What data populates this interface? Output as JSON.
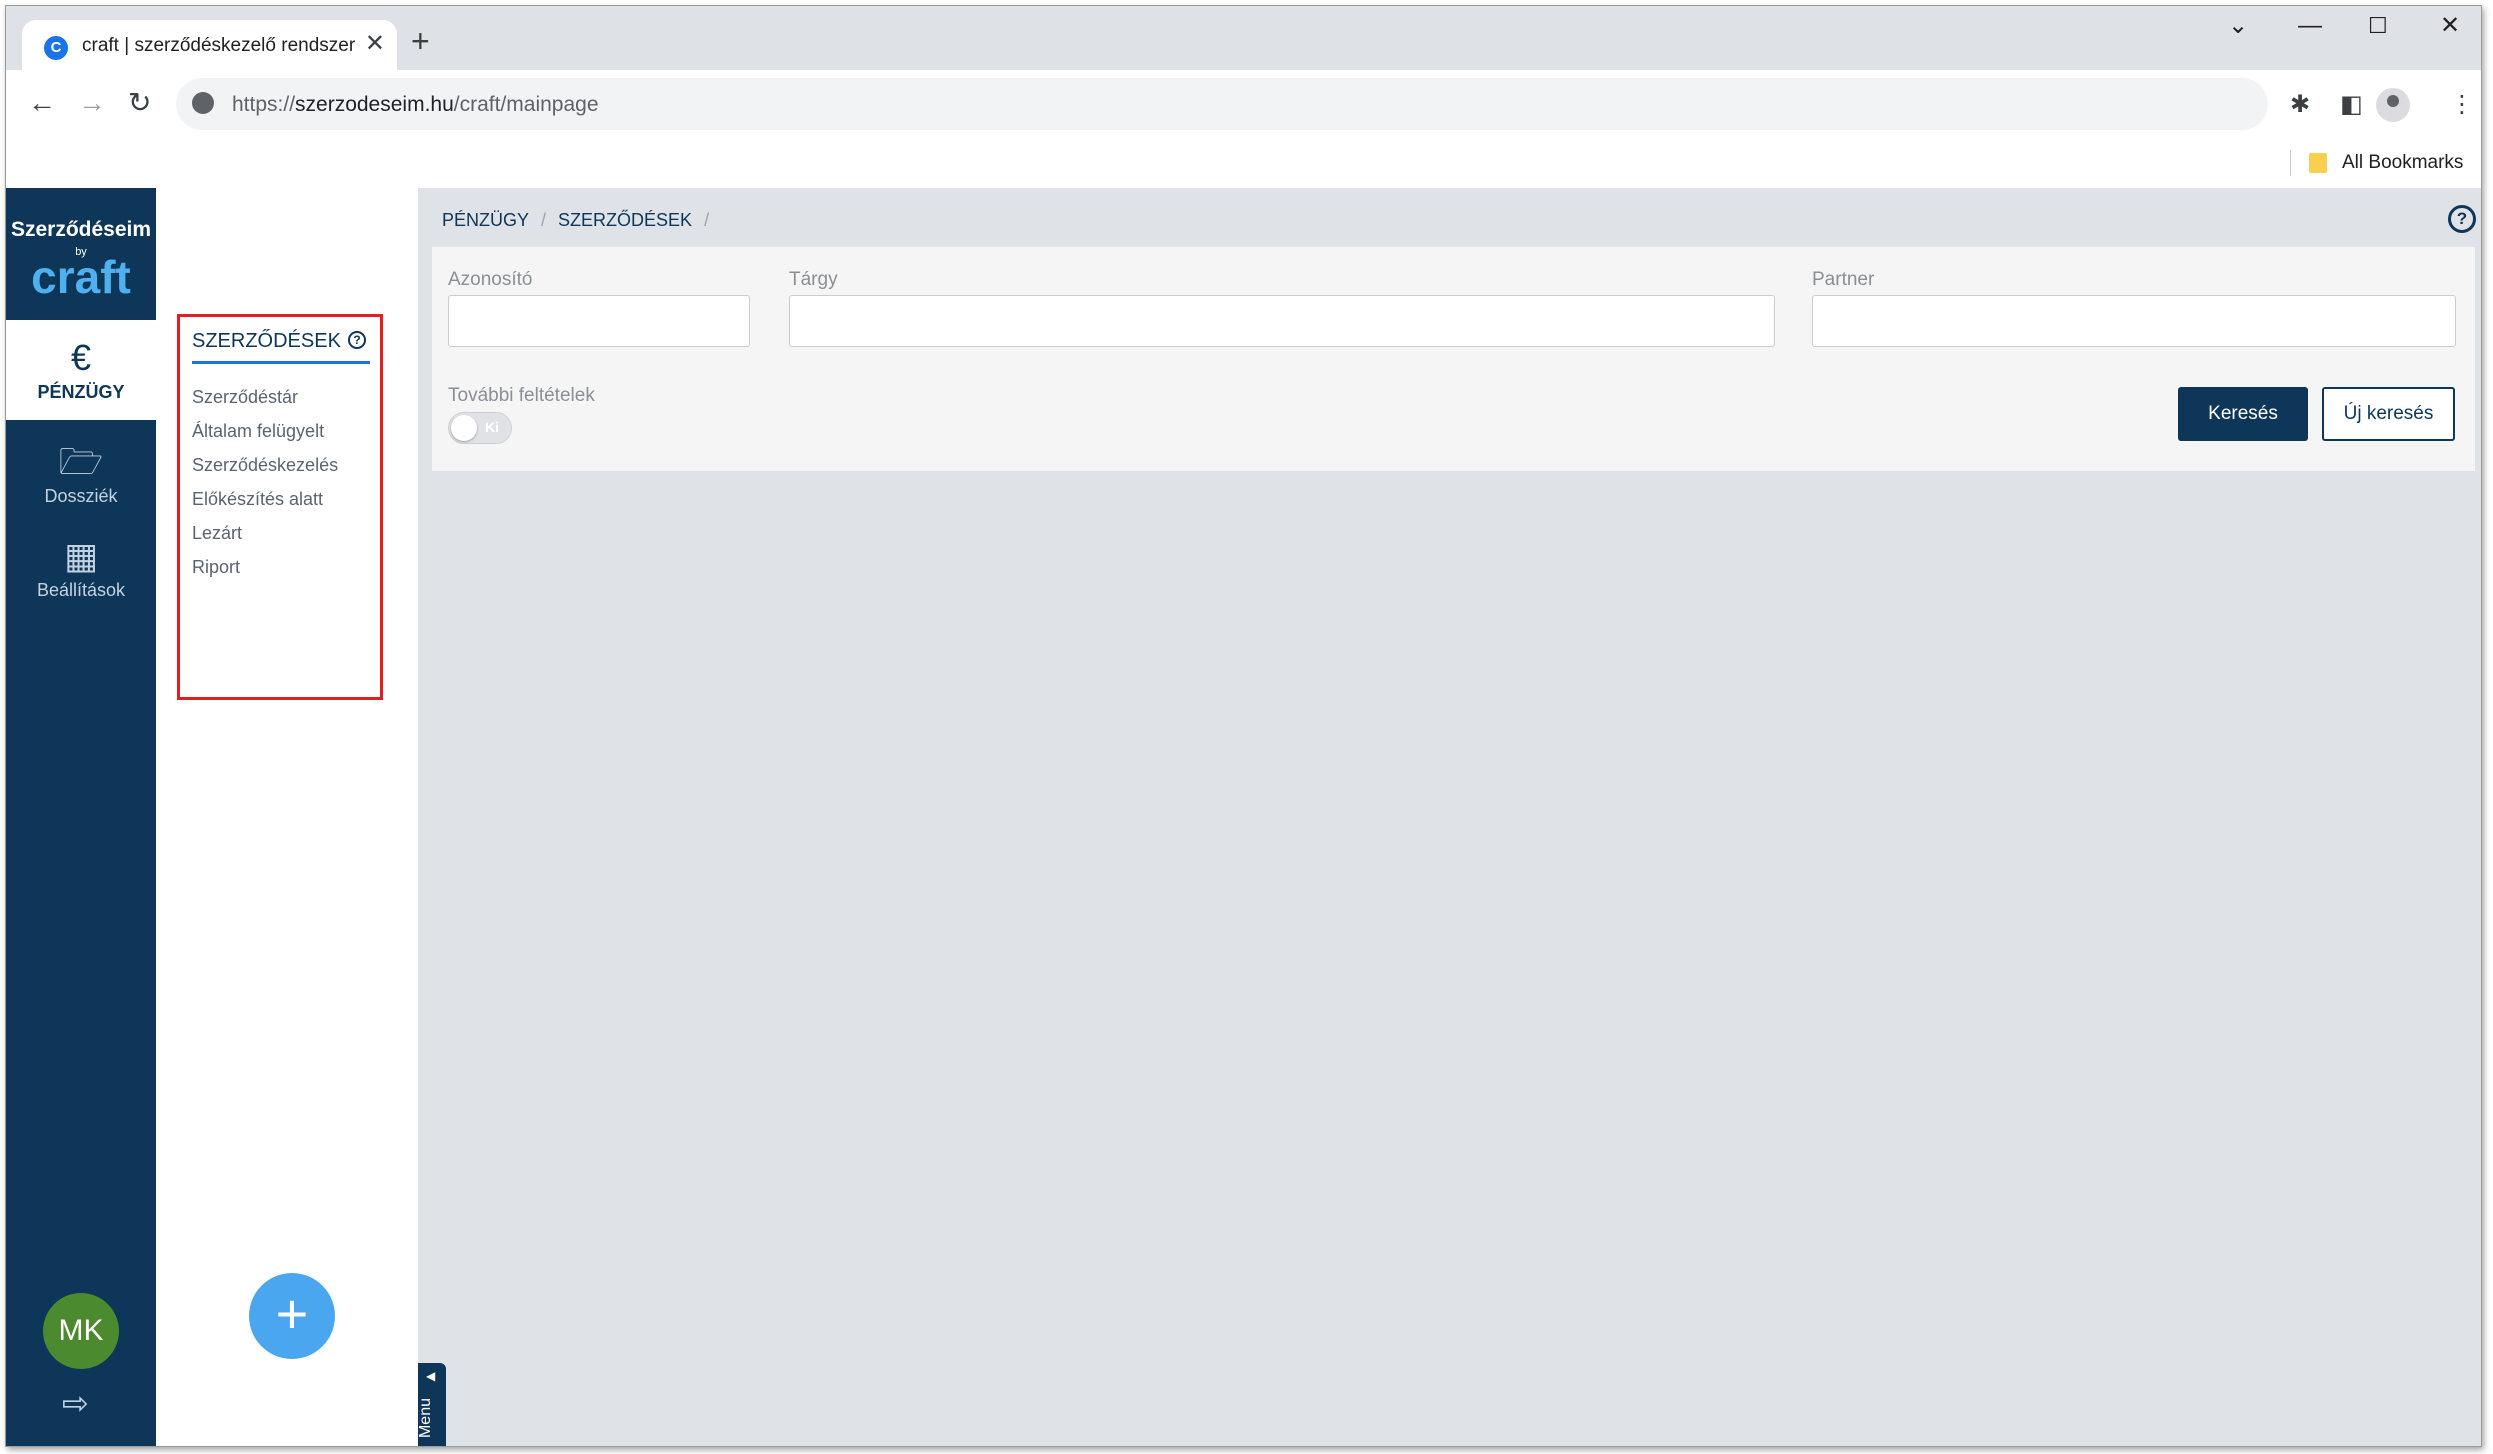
{
  "browser": {
    "tab_title": "craft | szerződéskezelő rendszer",
    "tab_favicon": "C",
    "url_prefix": "https://",
    "url_domain": "szerzodeseim.hu",
    "url_path": "/craft/mainpage",
    "bookmarks_label": "All Bookmarks"
  },
  "logo": {
    "top": "Szerződéseim",
    "by": "by",
    "brand": "craft"
  },
  "leftbar": {
    "items": [
      {
        "icon": "€",
        "label": "PÉNZÜGY"
      },
      {
        "icon": "🗁",
        "label": "Dossziék"
      },
      {
        "icon": "▦",
        "label": "Beállítások"
      }
    ],
    "user_initials": "MK"
  },
  "secnav": {
    "heading": "SZERZŐDÉSEK",
    "help": "?",
    "links": [
      "Szerződéstár",
      "Általam felügyelt",
      "Szerződéskezelés",
      "Előkészítés alatt",
      "Lezárt",
      "Riport"
    ],
    "fab": "+"
  },
  "breadcrumb": {
    "items": [
      "PÉNZÜGY",
      "SZERZŐDÉSEK"
    ],
    "separator": "/"
  },
  "search": {
    "fields": [
      {
        "label": "Azonosító",
        "value": ""
      },
      {
        "label": "Tárgy",
        "value": ""
      },
      {
        "label": "Partner",
        "value": ""
      }
    ],
    "extra_label": "További feltételek",
    "toggle_text": "Ki",
    "search_button": "Keresés",
    "new_search_button": "Új keresés"
  },
  "menu_handle": "Menu",
  "colors": {
    "navy": "#0e3658",
    "accent": "#4aa7ef",
    "avatar": "#4c8a2f",
    "highlight_box": "#e02020"
  }
}
